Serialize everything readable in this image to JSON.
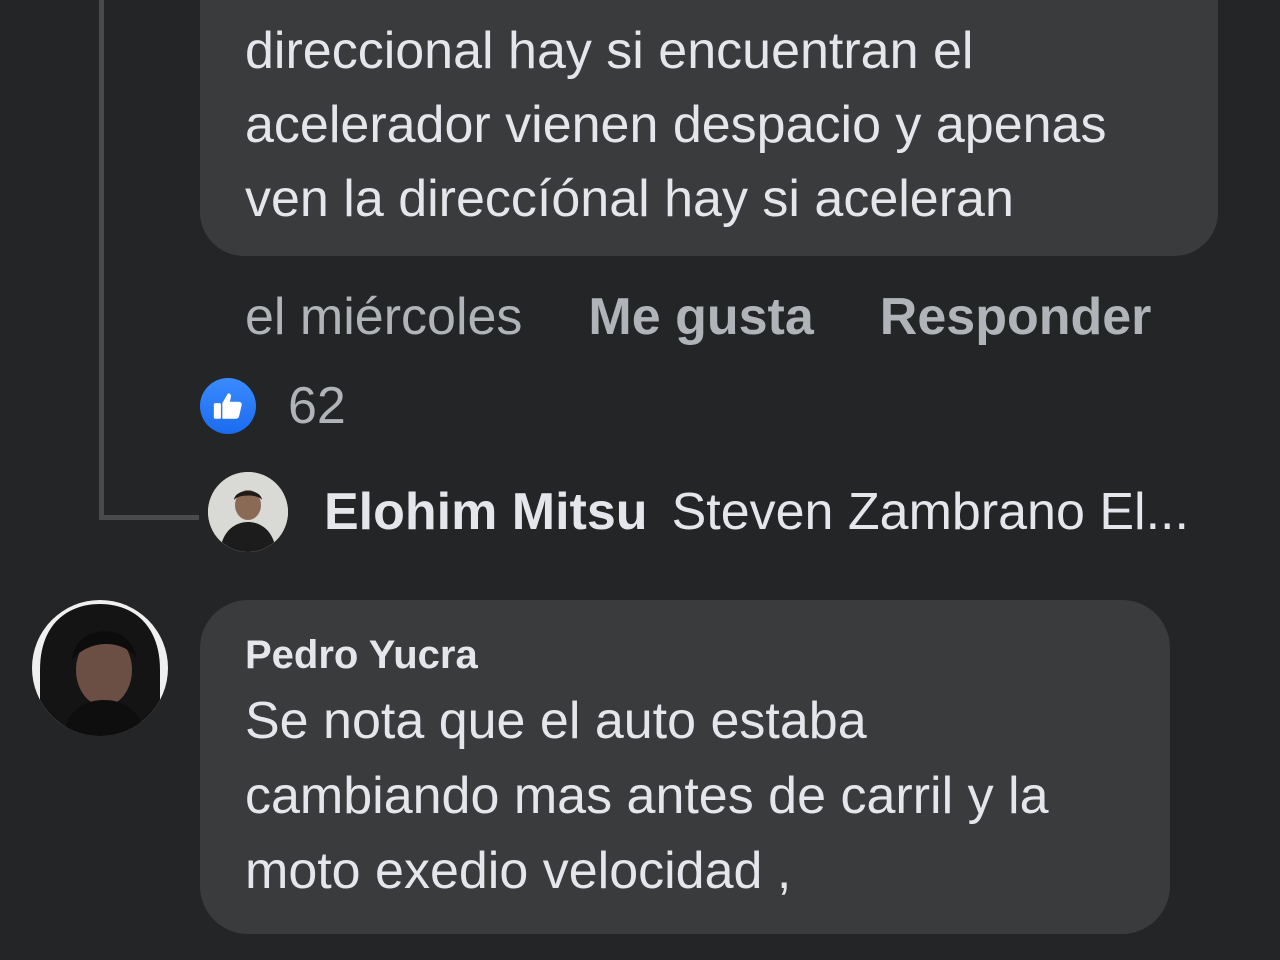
{
  "top_comment": {
    "text": "direccional hay si encuentran el\nacelerador vienen despacio y apenas\nven la direccíónal hay si aceleran",
    "timestamp": "el miércoles",
    "like_label": "Me gusta",
    "reply_label": "Responder",
    "reaction_icon": "thumbs-up-icon",
    "reaction_count": "62",
    "accent_color": "#1b74e4"
  },
  "reply_summary": {
    "author": "Elohim Mitsu",
    "snippet": "Steven Zambrano El..."
  },
  "comment": {
    "author": "Pedro Yucra",
    "text": "Se nota que el auto estaba\ncambiando mas antes de carril y la\nmoto exedio velocidad ,"
  },
  "theme": {
    "background": "#242526",
    "bubble": "#3a3b3c",
    "text": "#e4e6eb",
    "secondary_text": "#b0b3b8"
  }
}
